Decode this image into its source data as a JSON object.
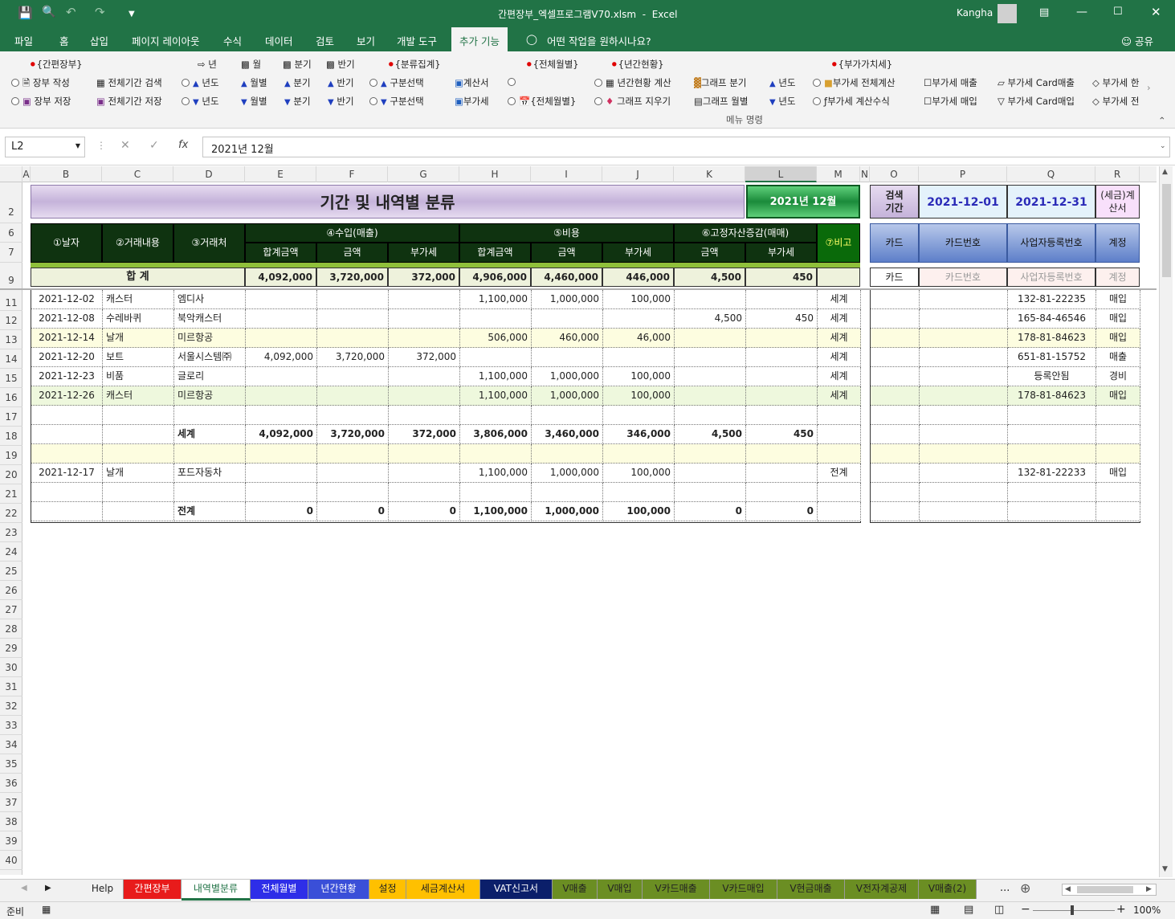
{
  "title": {
    "filename": "간편장부_엑셀프로그램V70.xlsm",
    "sep": "-",
    "app": "Excel",
    "user": "Kangha"
  },
  "menu_tabs": [
    "파일",
    "홈",
    "삽입",
    "페이지 레이아웃",
    "수식",
    "데이터",
    "검토",
    "보기",
    "개발 도구",
    "추가 기능"
  ],
  "tell_me": "어떤 작업을 원하시나요?",
  "share": "공유",
  "ribbon": {
    "g1_title": "{간편장부}",
    "g1_a": "장부 작성",
    "g1_b": "전체기간 검색",
    "g1_c": "장부 저장",
    "g1_d": "전체기간 저장",
    "g2_year": "년",
    "g2_month": "월",
    "g2_quarter": "분기",
    "g2_half": "반기",
    "g2_a1": "년도",
    "g2_a2": "월별",
    "g2_a3": "분기",
    "g2_a4": "반기",
    "g2_b1": "년도",
    "g2_b2": "월별",
    "g2_b3": "분기",
    "g2_b4": "반기",
    "g3_title": "{분류집계}",
    "g3_a": "구분선택",
    "g3_b": "구분선택",
    "g4_a": "계산서",
    "g4_b": "부가세",
    "g5_title": "{전체월별}",
    "g5_b": "{전체월별}",
    "g6_title": "{년간현황}",
    "g6_a": "년간현황 계산",
    "g6_a2": "그래프 분기",
    "g6_a3": "년도",
    "g6_b": "그래프 지우기",
    "g6_b2": "그래프 월별",
    "g6_b3": "년도",
    "g7_title": "{부가가치세}",
    "g7_a": "부가세 전체계산",
    "g7_a2": "부가세 매출",
    "g7_a3": "부가세 Card매출",
    "g7_a4": "부가세 한",
    "g7_b": "부가세 계산수식",
    "g7_b2": "부가세 매입",
    "g7_b3": "부가세 Card매입",
    "g7_b4": "부가세 전",
    "group_label": "메뉴 명령"
  },
  "formula": {
    "cell": "L2",
    "value": "2021년 12월"
  },
  "columns": [
    "A",
    "B",
    "C",
    "D",
    "E",
    "F",
    "G",
    "H",
    "I",
    "J",
    "K",
    "L",
    "M",
    "N",
    "O",
    "P",
    "Q",
    "R"
  ],
  "rows": [
    "2",
    "6",
    "7",
    "9",
    "11",
    "12",
    "13",
    "14",
    "15",
    "16",
    "17",
    "18",
    "19",
    "20",
    "21",
    "22",
    "23",
    "24",
    "25",
    "26",
    "27",
    "28",
    "29",
    "30",
    "31",
    "32",
    "33",
    "34",
    "35",
    "36",
    "37",
    "38",
    "39",
    "40"
  ],
  "sheet": {
    "title": "기간 및 내역별 분류",
    "period_button": "2021년 12월",
    "search_label": "검색\n기간",
    "start_date": "2021-12-01",
    "end_date": "2021-12-31",
    "invoice_label": "(세금)계\n산서",
    "h_date": "①날자",
    "h_content": "②거래내용",
    "h_partner": "③거래처",
    "h_income": "④수입(매출)",
    "h_cost": "⑤비용",
    "h_asset": "⑥고정자산증감(매매)",
    "h_note": "⑦비고",
    "h_total": "합계금액",
    "h_amount": "금액",
    "h_vat": "부가세",
    "h_total2": "합계금액",
    "h_amount2": "금액",
    "h_vat2": "부가세",
    "h_amount3": "금액",
    "h_vat3": "부가세",
    "h_card": "카드",
    "h_cardno": "카드번호",
    "h_bizno": "사업자등록번호",
    "h_account": "계정",
    "sum_label": "합      계",
    "sum": [
      "4,092,000",
      "3,720,000",
      "372,000",
      "4,906,000",
      "4,460,000",
      "446,000",
      "4,500",
      "450"
    ],
    "sum_r": [
      "카드",
      "카드번호",
      "사업자등록번호",
      "계정"
    ],
    "data_rows": [
      {
        "date": "2021-12-02",
        "content": "캐스터",
        "partner": "엠디사",
        "vals": [
          "",
          "",
          "",
          "1,100,000",
          "1,000,000",
          "100,000",
          "",
          ""
        ],
        "note": "세계",
        "card": "",
        "cardno": "",
        "biz": "132-81-22235",
        "acc": "매입",
        "bg": "#ffffff"
      },
      {
        "date": "2021-12-08",
        "content": "수레바퀴",
        "partner": "북악캐스터",
        "vals": [
          "",
          "",
          "",
          "",
          "",
          "",
          "4,500",
          "450"
        ],
        "note": "세계",
        "card": "",
        "cardno": "",
        "biz": "165-84-46546",
        "acc": "매입",
        "bg": "#ffffff"
      },
      {
        "date": "2021-12-14",
        "content": "날개",
        "partner": "미르항공",
        "vals": [
          "",
          "",
          "",
          "506,000",
          "460,000",
          "46,000",
          "",
          ""
        ],
        "note": "세계",
        "card": "",
        "cardno": "",
        "biz": "178-81-84623",
        "acc": "매입",
        "bg": "#fdfde0"
      },
      {
        "date": "2021-12-20",
        "content": "보트",
        "partner": "서울시스템㈜",
        "vals": [
          "4,092,000",
          "3,720,000",
          "372,000",
          "",
          "",
          "",
          "",
          ""
        ],
        "note": "세계",
        "card": "",
        "cardno": "",
        "biz": "651-81-15752",
        "acc": "매출",
        "bg": "#ffffff"
      },
      {
        "date": "2021-12-23",
        "content": "비품",
        "partner": "글로리",
        "vals": [
          "",
          "",
          "",
          "1,100,000",
          "1,000,000",
          "100,000",
          "",
          ""
        ],
        "note": "세계",
        "card": "",
        "cardno": "",
        "biz": "등록안됨",
        "acc": "경비",
        "bg": "#ffffff"
      },
      {
        "date": "2021-12-26",
        "content": "캐스터",
        "partner": "미르항공",
        "vals": [
          "",
          "",
          "",
          "1,100,000",
          "1,000,000",
          "100,000",
          "",
          ""
        ],
        "note": "세계",
        "card": "",
        "cardno": "",
        "biz": "178-81-84623",
        "acc": "매입",
        "bg": "#eef8dd"
      },
      {
        "date": "",
        "content": "",
        "partner": "",
        "vals": [
          "",
          "",
          "",
          "",
          "",
          "",
          "",
          ""
        ],
        "note": "",
        "card": "",
        "cardno": "",
        "biz": "",
        "acc": "",
        "bg": "#ffffff"
      },
      {
        "date": "",
        "content": "",
        "partner": "세계",
        "vals": [
          "4,092,000",
          "3,720,000",
          "372,000",
          "3,806,000",
          "3,460,000",
          "346,000",
          "4,500",
          "450"
        ],
        "note": "",
        "card": "",
        "cardno": "",
        "biz": "",
        "acc": "",
        "bg": "#ffffff",
        "bold": true
      },
      {
        "date": "",
        "content": "",
        "partner": "",
        "vals": [
          "",
          "",
          "",
          "",
          "",
          "",
          "",
          ""
        ],
        "note": "",
        "card": "",
        "cardno": "",
        "biz": "",
        "acc": "",
        "bg": "#fdfde0"
      },
      {
        "date": "2021-12-17",
        "content": "날개",
        "partner": "포드자동차",
        "vals": [
          "",
          "",
          "",
          "1,100,000",
          "1,000,000",
          "100,000",
          "",
          ""
        ],
        "note": "전계",
        "card": "",
        "cardno": "",
        "biz": "132-81-22233",
        "acc": "매입",
        "bg": "#ffffff"
      },
      {
        "date": "",
        "content": "",
        "partner": "",
        "vals": [
          "",
          "",
          "",
          "",
          "",
          "",
          "",
          ""
        ],
        "note": "",
        "card": "",
        "cardno": "",
        "biz": "",
        "acc": "",
        "bg": "#ffffff"
      },
      {
        "date": "",
        "content": "",
        "partner": "전계",
        "vals": [
          "0",
          "0",
          "0",
          "1,100,000",
          "1,000,000",
          "100,000",
          "0",
          "0"
        ],
        "note": "",
        "card": "",
        "cardno": "",
        "biz": "",
        "acc": "",
        "bg": "#ffffff",
        "bold": true
      }
    ]
  },
  "sheet_tabs": [
    {
      "label": "Help",
      "bg": "#f1f1f1",
      "fg": "#222"
    },
    {
      "label": "간편장부",
      "bg": "#e81b1b",
      "fg": "#ffffff"
    },
    {
      "label": "내역별분류",
      "bg": "#ffffff",
      "fg": "#217346"
    },
    {
      "label": "전체월별",
      "bg": "#2e2ee8",
      "fg": "#ffffff"
    },
    {
      "label": "년간현황",
      "bg": "#3a4fd8",
      "fg": "#ffffff"
    },
    {
      "label": "설정",
      "bg": "#ffc000",
      "fg": "#222"
    },
    {
      "label": "세금계산서",
      "bg": "#ffc000",
      "fg": "#222"
    },
    {
      "label": "VAT신고서",
      "bg": "#0b1f6a",
      "fg": "#ffffff"
    },
    {
      "label": "V매출",
      "bg": "#6b8e23",
      "fg": "#222"
    },
    {
      "label": "V매입",
      "bg": "#6b8e23",
      "fg": "#222"
    },
    {
      "label": "V카드매출",
      "bg": "#6b8e23",
      "fg": "#222"
    },
    {
      "label": "V카드매입",
      "bg": "#6b8e23",
      "fg": "#222"
    },
    {
      "label": "V현금매출",
      "bg": "#6b8e23",
      "fg": "#222"
    },
    {
      "label": "V전자계공제",
      "bg": "#6b8e23",
      "fg": "#222"
    },
    {
      "label": "V매출(2)",
      "bg": "#6b8e23",
      "fg": "#222"
    }
  ],
  "tab_more": "...",
  "status": {
    "ready": "준비",
    "zoom": "100%"
  }
}
